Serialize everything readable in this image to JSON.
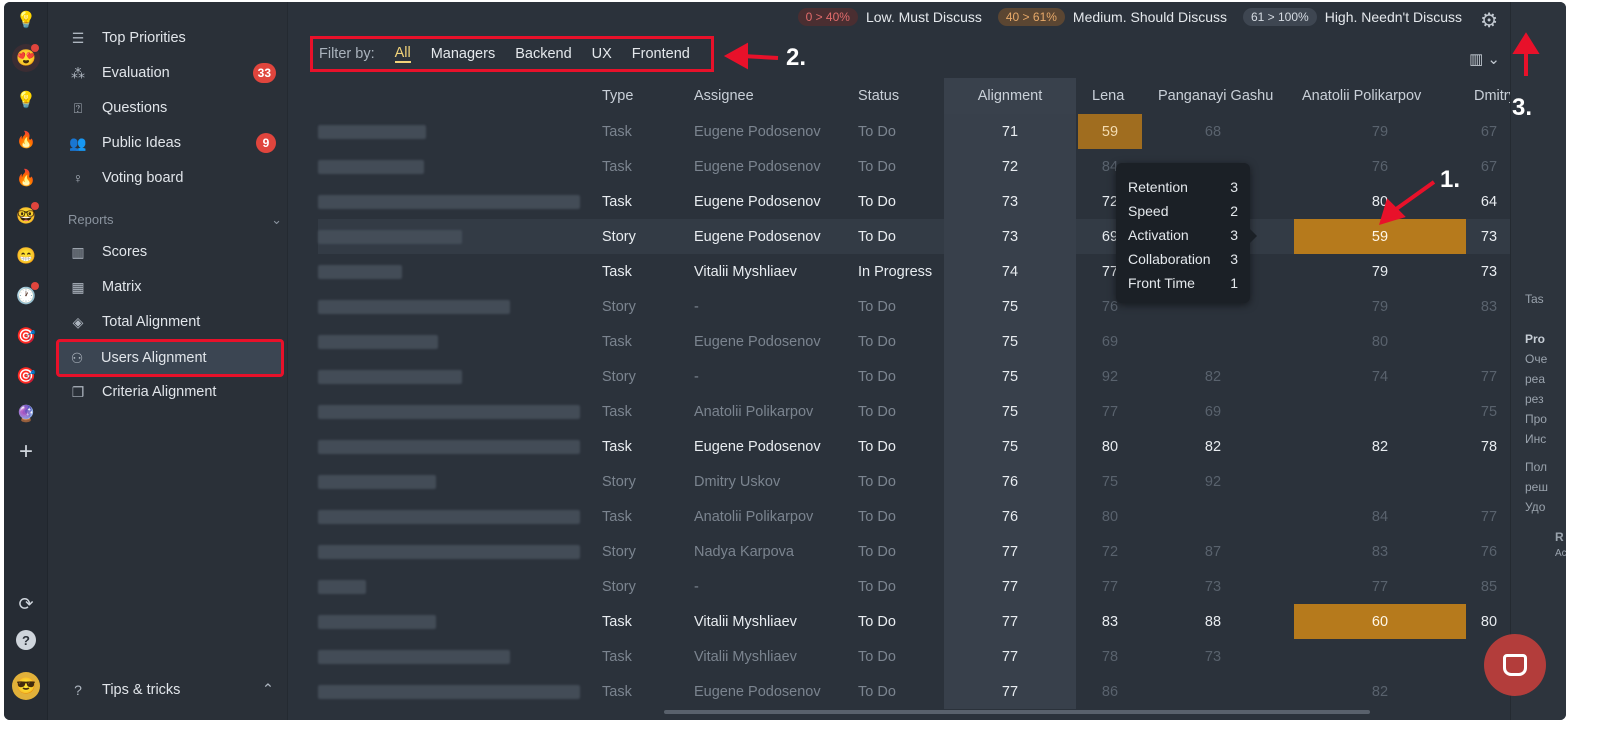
{
  "legend": [
    {
      "range": "0 > 40%",
      "label": "Low. Must Discuss",
      "kind": "low"
    },
    {
      "range": "40 > 61%",
      "label": "Medium. Should Discuss",
      "kind": "med"
    },
    {
      "range": "61 > 100%",
      "label": "High. Needn't Discuss",
      "kind": "high"
    }
  ],
  "sidebar": {
    "items": [
      {
        "label": "Top Priorities",
        "icon": "list-icon"
      },
      {
        "label": "Evaluation",
        "icon": "nodes-icon",
        "badge": "33"
      },
      {
        "label": "Questions",
        "icon": "question-icon"
      },
      {
        "label": "Public Ideas",
        "icon": "people-icon",
        "badge": "9"
      },
      {
        "label": "Voting board",
        "icon": "bulb-icon"
      }
    ],
    "section_label": "Reports",
    "reports": [
      {
        "label": "Scores",
        "icon": "columns-icon"
      },
      {
        "label": "Matrix",
        "icon": "grid-icon"
      },
      {
        "label": "Total Alignment",
        "icon": "layers-icon"
      },
      {
        "label": "Users Alignment",
        "icon": "users-add-icon",
        "active": true
      },
      {
        "label": "Criteria Alignment",
        "icon": "copy-icon"
      }
    ],
    "tips": "Tips & tricks"
  },
  "filter": {
    "label": "Filter by:",
    "options": [
      "All",
      "Managers",
      "Backend",
      "UX",
      "Frontend"
    ],
    "active": "All"
  },
  "table": {
    "headers": {
      "type": "Type",
      "assignee": "Assignee",
      "status": "Status",
      "alignment": "Alignment",
      "lena": "Lena",
      "pan": "Panganayi Gashu",
      "ana": "Anatolii Polikarpov",
      "dmi": "Dmitry Us"
    },
    "rows": [
      {
        "type": "Task",
        "assignee": "Eugene Podosenov",
        "status": "To Do",
        "alignment": "71",
        "lena": "59",
        "pan": "68",
        "ana": "79",
        "dmi": "67",
        "dim": true,
        "hl": "lena"
      },
      {
        "type": "Task",
        "assignee": "Eugene Podosenov",
        "status": "To Do",
        "alignment": "72",
        "lena": "84",
        "pan": "",
        "ana": "76",
        "dmi": "67",
        "dim": true
      },
      {
        "type": "Task",
        "assignee": "Eugene Podosenov",
        "status": "To Do",
        "alignment": "73",
        "lena": "72",
        "pan": "",
        "ana": "80",
        "dmi": "64",
        "dim": false
      },
      {
        "type": "Story",
        "assignee": "Eugene Podosenov",
        "status": "To Do",
        "alignment": "73",
        "lena": "69",
        "pan": "",
        "ana": "59",
        "dmi": "73",
        "dim": false,
        "hl": "ana",
        "rowhl": true
      },
      {
        "type": "Task",
        "assignee": "Vitalii Myshliaev",
        "status": "In Progress",
        "alignment": "74",
        "lena": "77",
        "pan": "",
        "ana": "79",
        "dmi": "73",
        "dim": false
      },
      {
        "type": "Story",
        "assignee": "-",
        "status": "To Do",
        "alignment": "75",
        "lena": "76",
        "pan": "",
        "ana": "79",
        "dmi": "83",
        "dim": true
      },
      {
        "type": "Task",
        "assignee": "Eugene Podosenov",
        "status": "To Do",
        "alignment": "75",
        "lena": "69",
        "pan": "",
        "ana": "80",
        "dmi": "",
        "dim": true
      },
      {
        "type": "Story",
        "assignee": "-",
        "status": "To Do",
        "alignment": "75",
        "lena": "92",
        "pan": "82",
        "ana": "74",
        "dmi": "77",
        "dim": true
      },
      {
        "type": "Task",
        "assignee": "Anatolii Polikarpov",
        "status": "To Do",
        "alignment": "75",
        "lena": "77",
        "pan": "69",
        "ana": "",
        "dmi": "75",
        "dim": true
      },
      {
        "type": "Task",
        "assignee": "Eugene Podosenov",
        "status": "To Do",
        "alignment": "75",
        "lena": "80",
        "pan": "82",
        "ana": "82",
        "dmi": "78",
        "dim": false
      },
      {
        "type": "Story",
        "assignee": "Dmitry Uskov",
        "status": "To Do",
        "alignment": "76",
        "lena": "75",
        "pan": "92",
        "ana": "",
        "dmi": "",
        "dim": true
      },
      {
        "type": "Task",
        "assignee": "Anatolii Polikarpov",
        "status": "To Do",
        "alignment": "76",
        "lena": "80",
        "pan": "",
        "ana": "84",
        "dmi": "77",
        "dim": true
      },
      {
        "type": "Story",
        "assignee": "Nadya Karpova",
        "status": "To Do",
        "alignment": "77",
        "lena": "72",
        "pan": "87",
        "ana": "83",
        "dmi": "76",
        "dim": true
      },
      {
        "type": "Story",
        "assignee": "-",
        "status": "To Do",
        "alignment": "77",
        "lena": "77",
        "pan": "73",
        "ana": "77",
        "dmi": "85",
        "dim": true
      },
      {
        "type": "Task",
        "assignee": "Vitalii Myshliaev",
        "status": "To Do",
        "alignment": "77",
        "lena": "83",
        "pan": "88",
        "ana": "60",
        "dmi": "80",
        "dim": false,
        "hl": "ana"
      },
      {
        "type": "Task",
        "assignee": "Vitalii Myshliaev",
        "status": "To Do",
        "alignment": "77",
        "lena": "78",
        "pan": "73",
        "ana": "",
        "dmi": "",
        "dim": true
      },
      {
        "type": "Task",
        "assignee": "Eugene Podosenov",
        "status": "To Do",
        "alignment": "77",
        "lena": "86",
        "pan": "",
        "ana": "82",
        "dmi": "",
        "dim": true
      }
    ]
  },
  "tooltip": [
    {
      "k": "Retention",
      "v": "3"
    },
    {
      "k": "Speed",
      "v": "2"
    },
    {
      "k": "Activation",
      "v": "3"
    },
    {
      "k": "Collaboration",
      "v": "3"
    },
    {
      "k": "Front Time",
      "v": "1"
    }
  ],
  "annotations": [
    "1.",
    "2.",
    "3."
  ],
  "right_pane": {
    "t1": "Tas",
    "t2": "Pro",
    "t3": "Оче",
    "t4": "реа",
    "t5": "рез",
    "t6": "Про",
    "t7": "Инс",
    "t8": "Пол",
    "t9": "реш",
    "t10": "Удо",
    "t11": "R",
    "t12": "Ac"
  }
}
